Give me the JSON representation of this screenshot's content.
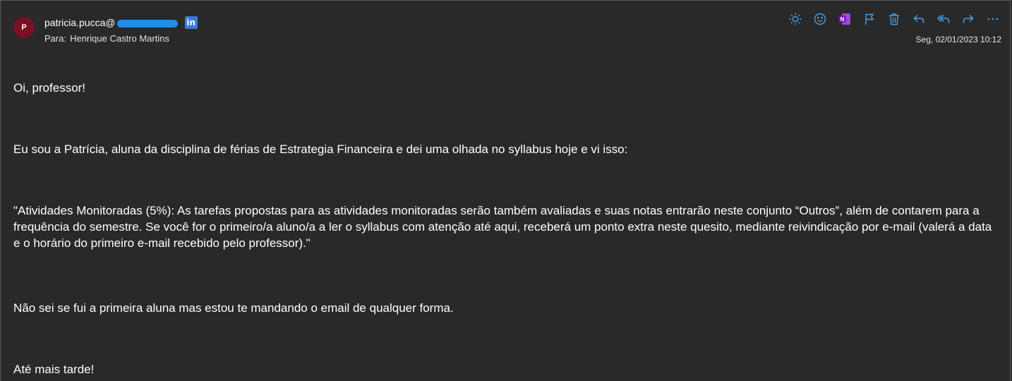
{
  "header": {
    "avatar_initial": "P",
    "sender_prefix": "patricia.pucca@",
    "to_label": "Para:",
    "to_name": "Henrique Castro Martins",
    "date": "Seg, 02/01/2023 10:12",
    "linkedin_label": "in"
  },
  "toolbar": {
    "icons": [
      "sun-icon",
      "emoji-icon",
      "onenote-icon",
      "flag-icon",
      "trash-icon",
      "reply-icon",
      "reply-all-icon",
      "forward-icon",
      "more-icon"
    ],
    "onenote_label": "N",
    "more_label": "···"
  },
  "colors": {
    "accent": "#4aa0e6",
    "avatar": "#7a1024",
    "onenote": "#7719aa",
    "redaction": "#1f8ee6"
  },
  "body": {
    "greeting": "Oi, professor!",
    "intro": "Eu sou a Patrícia, aluna da disciplina de férias de Estrategia Financeira e dei uma olhada no syllabus hoje e vi isso:",
    "quote": "\"Atividades Monitoradas (5%): As tarefas propostas para as atividades monitoradas serão também avaliadas e suas notas entrarão neste conjunto “Outros”, além de contarem para a frequência do semestre. Se você for o primeiro/a aluno/a a ler o syllabus com atenção até aqui, receberá um ponto extra neste quesito, mediante reivindicação por e-mail (valerá a data e o horário do primeiro e-mail recebido pelo professor).\"",
    "statement": "Não sei se fui a primeira aluna mas estou te mandando o email de qualquer forma.",
    "closing": "Até mais tarde!"
  }
}
